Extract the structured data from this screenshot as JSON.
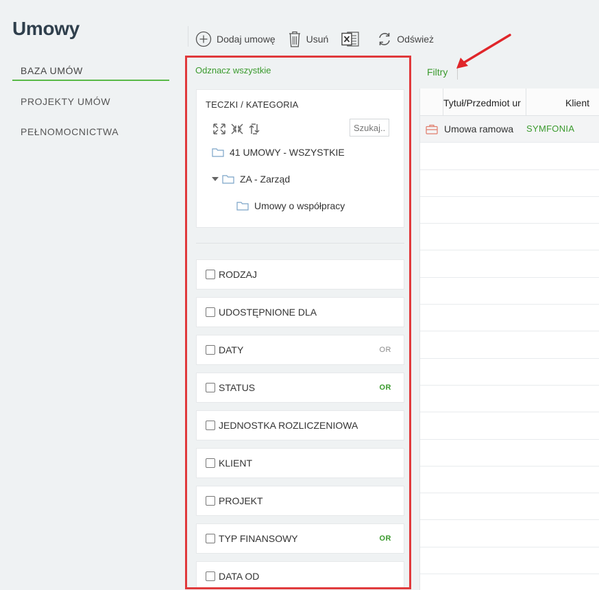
{
  "page": {
    "title": "Umowy"
  },
  "nav": {
    "items": [
      {
        "label": "BAZA UMÓW",
        "active": true
      },
      {
        "label": "PROJEKTY UMÓW",
        "active": false
      },
      {
        "label": "PEŁNOMOCNICTWA",
        "active": false
      }
    ]
  },
  "toolbar": {
    "add_label": "Dodaj umowę",
    "delete_label": "Usuń",
    "refresh_label": "Odśwież",
    "excel_icon": "excel-icon"
  },
  "filters": {
    "select_all": "Odznacz wszystkie",
    "tree": {
      "title": "TECZKI / KATEGORIA",
      "search_placeholder": "Szukaj...",
      "nodes": [
        {
          "label": "41 UMOWY - WSZYSTKIE"
        },
        {
          "label": "ZA - Zarząd"
        },
        {
          "label": "Umowy o współpracy"
        }
      ]
    },
    "rows": [
      {
        "label": "RODZAJ",
        "or": ""
      },
      {
        "label": "UDOSTĘPNIONE DLA",
        "or": ""
      },
      {
        "label": "DATY",
        "or": "OR"
      },
      {
        "label": "STATUS",
        "or": "OR"
      },
      {
        "label": "JEDNOSTKA ROZLICZENIOWA",
        "or": ""
      },
      {
        "label": "KLIENT",
        "or": ""
      },
      {
        "label": "PROJEKT",
        "or": ""
      },
      {
        "label": "TYP FINANSOWY",
        "or": "OR"
      },
      {
        "label": "DATA OD",
        "or": ""
      }
    ]
  },
  "grid": {
    "filters_label": "Filtry",
    "columns": [
      "Tytuł/Przedmiot ur",
      "Klient"
    ],
    "rows": [
      {
        "title": "Umowa ramowa",
        "client": "SYMFONIA"
      }
    ]
  },
  "colors": {
    "accent": "#3a9a2d",
    "highlight": "#e0393b",
    "nav_underline": "#58b947"
  }
}
